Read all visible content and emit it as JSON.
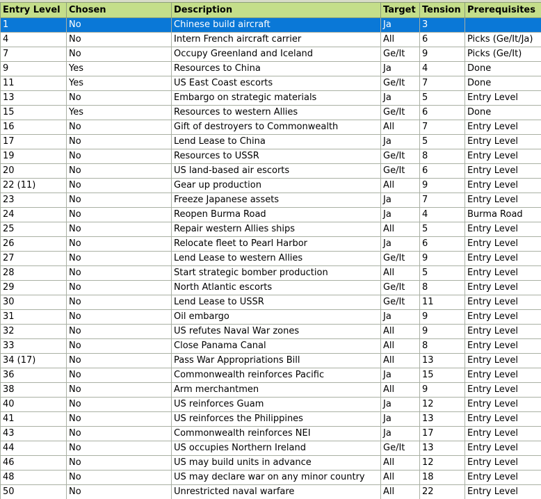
{
  "columns": [
    "Entry Level",
    "Chosen",
    "Description",
    "Target",
    "Tension",
    "Prerequisites"
  ],
  "colors": {
    "header_bg": "#c4de8a",
    "selected_row_bg": "#0a78d7",
    "grid_line": "#a9b0a3"
  },
  "selected_row": 0,
  "rows": [
    [
      "1",
      "No",
      "Chinese build aircraft",
      "Ja",
      "3",
      ""
    ],
    [
      "4",
      "No",
      "Intern French aircraft carrier",
      "All",
      "6",
      "Picks (Ge/It/Ja)"
    ],
    [
      "7",
      "No",
      "Occupy Greenland and Iceland",
      "Ge/It",
      "9",
      "Picks (Ge/It)"
    ],
    [
      "9",
      "Yes",
      "Resources to China",
      "Ja",
      "4",
      "Done"
    ],
    [
      "11",
      "Yes",
      "US East Coast escorts",
      "Ge/It",
      "7",
      "Done"
    ],
    [
      "13",
      "No",
      "Embargo on strategic materials",
      "Ja",
      "5",
      "Entry Level"
    ],
    [
      "15",
      "Yes",
      "Resources to western Allies",
      "Ge/It",
      "6",
      "Done"
    ],
    [
      "16",
      "No",
      "Gift of destroyers to Commonwealth",
      "All",
      "7",
      "Entry Level"
    ],
    [
      "17",
      "No",
      "Lend Lease to China",
      "Ja",
      "5",
      "Entry Level"
    ],
    [
      "19",
      "No",
      "Resources to USSR",
      "Ge/It",
      "8",
      "Entry Level"
    ],
    [
      "20",
      "No",
      "US land-based air escorts",
      "Ge/It",
      "6",
      "Entry Level"
    ],
    [
      "22 (11)",
      "No",
      "Gear up production",
      "All",
      "9",
      "Entry Level"
    ],
    [
      "23",
      "No",
      "Freeze Japanese assets",
      "Ja",
      "7",
      "Entry Level"
    ],
    [
      "24",
      "No",
      "Reopen Burma Road",
      "Ja",
      "4",
      "Burma Road"
    ],
    [
      "25",
      "No",
      "Repair western Allies ships",
      "All",
      "5",
      "Entry Level"
    ],
    [
      "26",
      "No",
      "Relocate fleet to Pearl Harbor",
      "Ja",
      "6",
      "Entry Level"
    ],
    [
      "27",
      "No",
      "Lend Lease to western Allies",
      "Ge/It",
      "9",
      "Entry Level"
    ],
    [
      "28",
      "No",
      "Start strategic bomber production",
      "All",
      "5",
      "Entry Level"
    ],
    [
      "29",
      "No",
      "North Atlantic escorts",
      "Ge/It",
      "8",
      "Entry Level"
    ],
    [
      "30",
      "No",
      "Lend Lease to USSR",
      "Ge/It",
      "11",
      "Entry Level"
    ],
    [
      "31",
      "No",
      "Oil embargo",
      "Ja",
      "9",
      "Entry Level"
    ],
    [
      "32",
      "No",
      "US refutes Naval War zones",
      "All",
      "9",
      "Entry Level"
    ],
    [
      "33",
      "No",
      "Close Panama Canal",
      "All",
      "8",
      "Entry Level"
    ],
    [
      "34 (17)",
      "No",
      "Pass War Appropriations Bill",
      "All",
      "13",
      "Entry Level"
    ],
    [
      "36",
      "No",
      "Commonwealth reinforces Pacific",
      "Ja",
      "15",
      "Entry Level"
    ],
    [
      "38",
      "No",
      "Arm merchantmen",
      "All",
      "9",
      "Entry Level"
    ],
    [
      "40",
      "No",
      "US reinforces Guam",
      "Ja",
      "12",
      "Entry Level"
    ],
    [
      "41",
      "No",
      "US reinforces the Philippines",
      "Ja",
      "13",
      "Entry Level"
    ],
    [
      "43",
      "No",
      "Commonwealth reinforces NEI",
      "Ja",
      "17",
      "Entry Level"
    ],
    [
      "44",
      "No",
      "US occupies Northern Ireland",
      "Ge/It",
      "13",
      "Entry Level"
    ],
    [
      "46",
      "No",
      "US may build units in advance",
      "All",
      "12",
      "Entry Level"
    ],
    [
      "48",
      "No",
      "US may declare war on any minor country",
      "All",
      "18",
      "Entry Level"
    ],
    [
      "50",
      "No",
      "Unrestricted naval warfare",
      "All",
      "22",
      "Entry Level"
    ]
  ]
}
